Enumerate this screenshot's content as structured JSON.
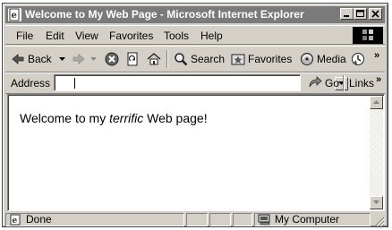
{
  "window": {
    "title": "Welcome to My Web Page - Microsoft Internet Explorer",
    "minimize_glyph": "_",
    "maximize_glyph": "□",
    "close_glyph": "×"
  },
  "menu": {
    "items": [
      "File",
      "Edit",
      "View",
      "Favorites",
      "Tools",
      "Help"
    ]
  },
  "toolbar": {
    "back_label": "Back",
    "search_label": "Search",
    "favorites_label": "Favorites",
    "media_label": "Media",
    "overflow_glyph": "»"
  },
  "address": {
    "label": "Address",
    "value": "",
    "go_label": "Go",
    "links_label": "Links",
    "links_overflow": "»"
  },
  "page": {
    "text_before": "Welcome to my ",
    "text_emphasis": "terrific",
    "text_after": " Web page!"
  },
  "status": {
    "text": "Done",
    "zone": "My Computer"
  },
  "icons": {
    "app": "ie-page-icon",
    "back": "back-arrow-icon",
    "forward": "forward-arrow-icon",
    "stop": "stop-icon",
    "refresh": "refresh-icon",
    "home": "home-icon",
    "search": "search-icon",
    "favorites": "favorites-icon",
    "media": "media-icon",
    "history": "history-icon",
    "go": "go-arrow-icon",
    "status_page": "page-icon",
    "zone": "computer-icon"
  }
}
